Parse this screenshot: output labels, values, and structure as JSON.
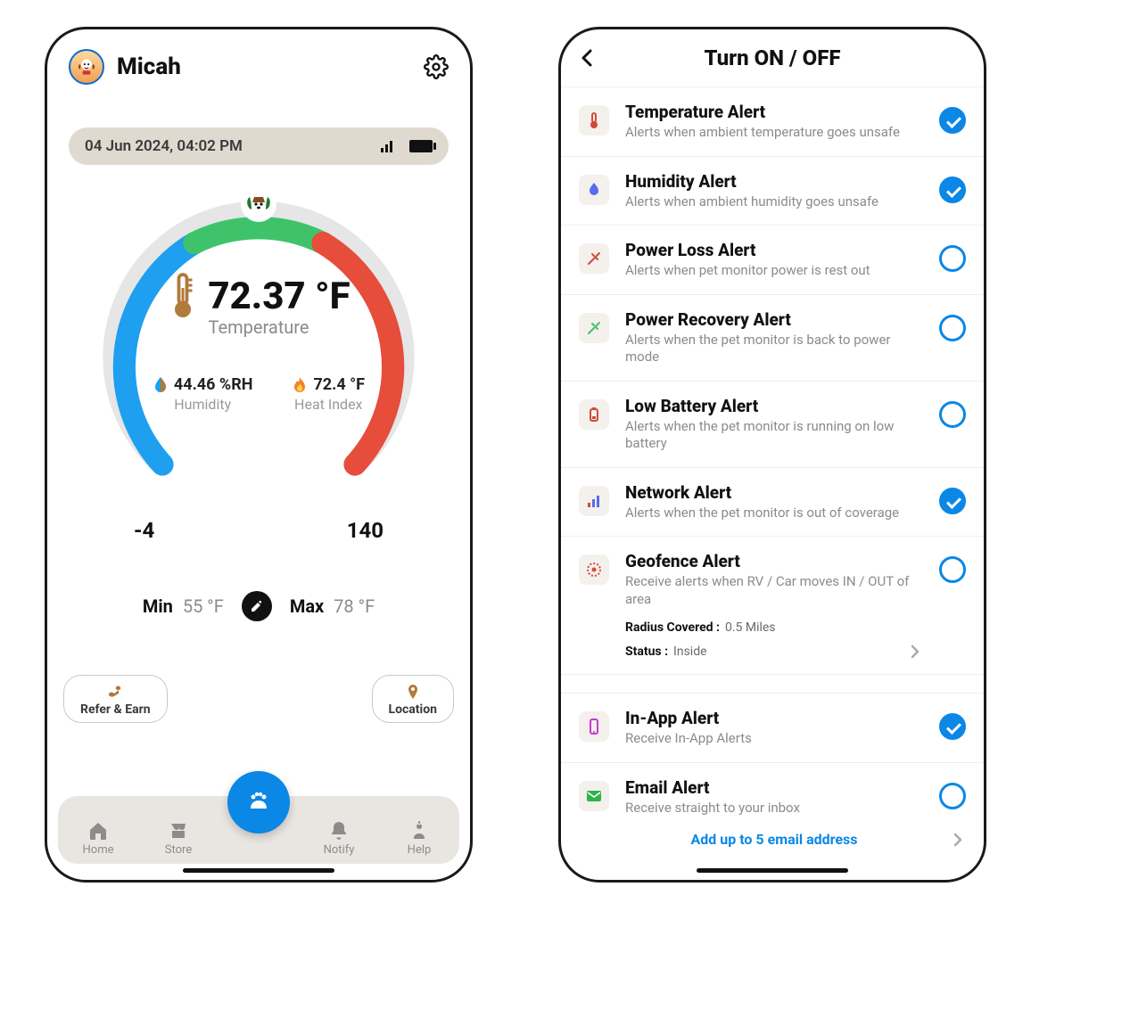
{
  "left": {
    "pet_name": "Micah",
    "status_timestamp": "04 Jun 2024,  04:02 PM",
    "gauge": {
      "temperature_value": "72.37 °F",
      "temperature_label": "Temperature",
      "humidity_value": "44.46 %RH",
      "humidity_label": "Humidity",
      "heat_index_value": "72.4 °F",
      "heat_index_label": "Heat Index",
      "range_low": "-4",
      "range_high": "140"
    },
    "minmax": {
      "min_label": "Min",
      "min_value": "55 °F",
      "max_label": "Max",
      "max_value": "78 °F"
    },
    "pills": {
      "refer": "Refer & Earn",
      "location": "Location"
    },
    "tabs": {
      "home": "Home",
      "store": "Store",
      "notify": "Notify",
      "help": "Help"
    }
  },
  "right": {
    "title": "Turn ON / OFF",
    "alerts": [
      {
        "title": "Temperature Alert",
        "desc": "Alerts when ambient temperature goes unsafe",
        "on": true
      },
      {
        "title": "Humidity Alert",
        "desc": "Alerts when ambient humidity goes unsafe",
        "on": true
      },
      {
        "title": "Power Loss Alert",
        "desc": "Alerts when pet monitor power is rest out",
        "on": false
      },
      {
        "title": "Power Recovery Alert",
        "desc": "Alerts when the pet monitor is back to power mode",
        "on": false
      },
      {
        "title": "Low Battery Alert",
        "desc": "Alerts when the pet monitor is running on low battery",
        "on": false
      },
      {
        "title": "Network Alert",
        "desc": "Alerts when the pet monitor is out of coverage",
        "on": true
      }
    ],
    "geofence": {
      "title": "Geofence Alert",
      "desc": "Receive alerts when RV / Car moves IN / OUT of area",
      "on": false,
      "radius_label": "Radius Covered :",
      "radius_value": "0.5 Miles",
      "status_label": "Status :",
      "status_value": "Inside"
    },
    "inapp": {
      "title": "In-App Alert",
      "desc": "Receive In-App Alerts",
      "on": true
    },
    "email": {
      "title": "Email Alert",
      "desc": "Receive straight to your inbox",
      "on": false,
      "add_link": "Add up to 5 email address"
    }
  }
}
